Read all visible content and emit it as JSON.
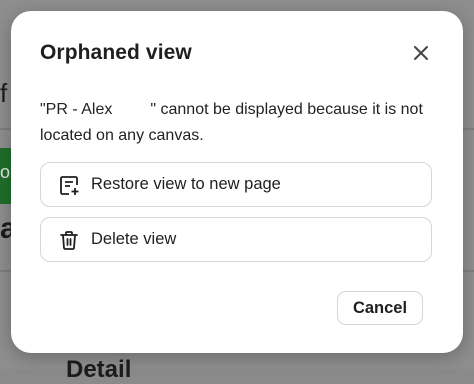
{
  "background": {
    "fragments": [
      "f l",
      "o",
      "a",
      "Detail"
    ]
  },
  "dialog": {
    "title": "Orphaned view",
    "message_prefix": "\"PR - Alex",
    "message_suffix": "\" cannot be displayed because it is not located on any canvas.",
    "options": [
      {
        "label": "Restore view to new page",
        "icon": "restore-page-icon"
      },
      {
        "label": "Delete view",
        "icon": "trash-icon"
      }
    ],
    "cancel_label": "Cancel",
    "close_icon": "close-icon"
  }
}
